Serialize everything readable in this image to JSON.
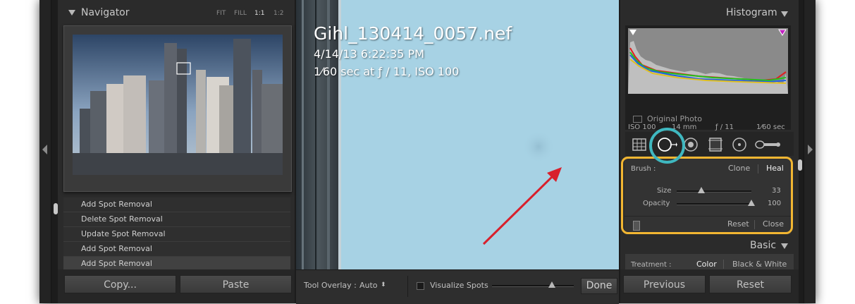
{
  "navigator": {
    "title": "Navigator",
    "zoom_options": [
      "FIT",
      "FILL",
      "1:1",
      "1:2"
    ],
    "selected_zoom": "1:1"
  },
  "history": {
    "items": [
      "Add Spot Removal",
      "Delete Spot Removal",
      "Update Spot Removal",
      "Add Spot Removal",
      "Add Spot Removal"
    ]
  },
  "left_buttons": {
    "copy": "Copy...",
    "paste": "Paste"
  },
  "photo": {
    "filename": "Gihl_130414_0057.nef",
    "datetime": "4/14/13 6:22:35 PM",
    "exposure": "1⁄60 sec at ƒ / 11, ISO 100"
  },
  "toolbar": {
    "tool_overlay_label": "Tool Overlay :",
    "tool_overlay_value": "Auto",
    "visualize_spots": "Visualize Spots",
    "done": "Done"
  },
  "histogram": {
    "title": "Histogram",
    "iso": "ISO 100",
    "focal": "14 mm",
    "aperture": "ƒ / 11",
    "shutter": "1⁄60 sec",
    "original_photo": "Original Photo"
  },
  "spot_removal": {
    "brush_label": "Brush :",
    "clone": "Clone",
    "heal": "Heal",
    "size_label": "Size",
    "size_value": "33",
    "size_fraction": 0.33,
    "opacity_label": "Opacity",
    "opacity_value": "100",
    "opacity_fraction": 1.0,
    "reset": "Reset",
    "close": "Close"
  },
  "basic": {
    "title": "Basic",
    "treatment_label": "Treatment :",
    "color": "Color",
    "bw": "Black & White"
  },
  "right_buttons": {
    "previous": "Previous",
    "reset": "Reset"
  },
  "colors": {
    "highlight_ring": "#3fb8c0",
    "highlight_box": "#f2b632",
    "arrow": "#d8202c",
    "sky": "#a7d2e4"
  },
  "icons": [
    "crop-overlay-icon",
    "spot-removal-icon",
    "red-eye-icon",
    "graduated-filter-icon",
    "radial-filter-icon",
    "adjustment-brush-icon"
  ]
}
